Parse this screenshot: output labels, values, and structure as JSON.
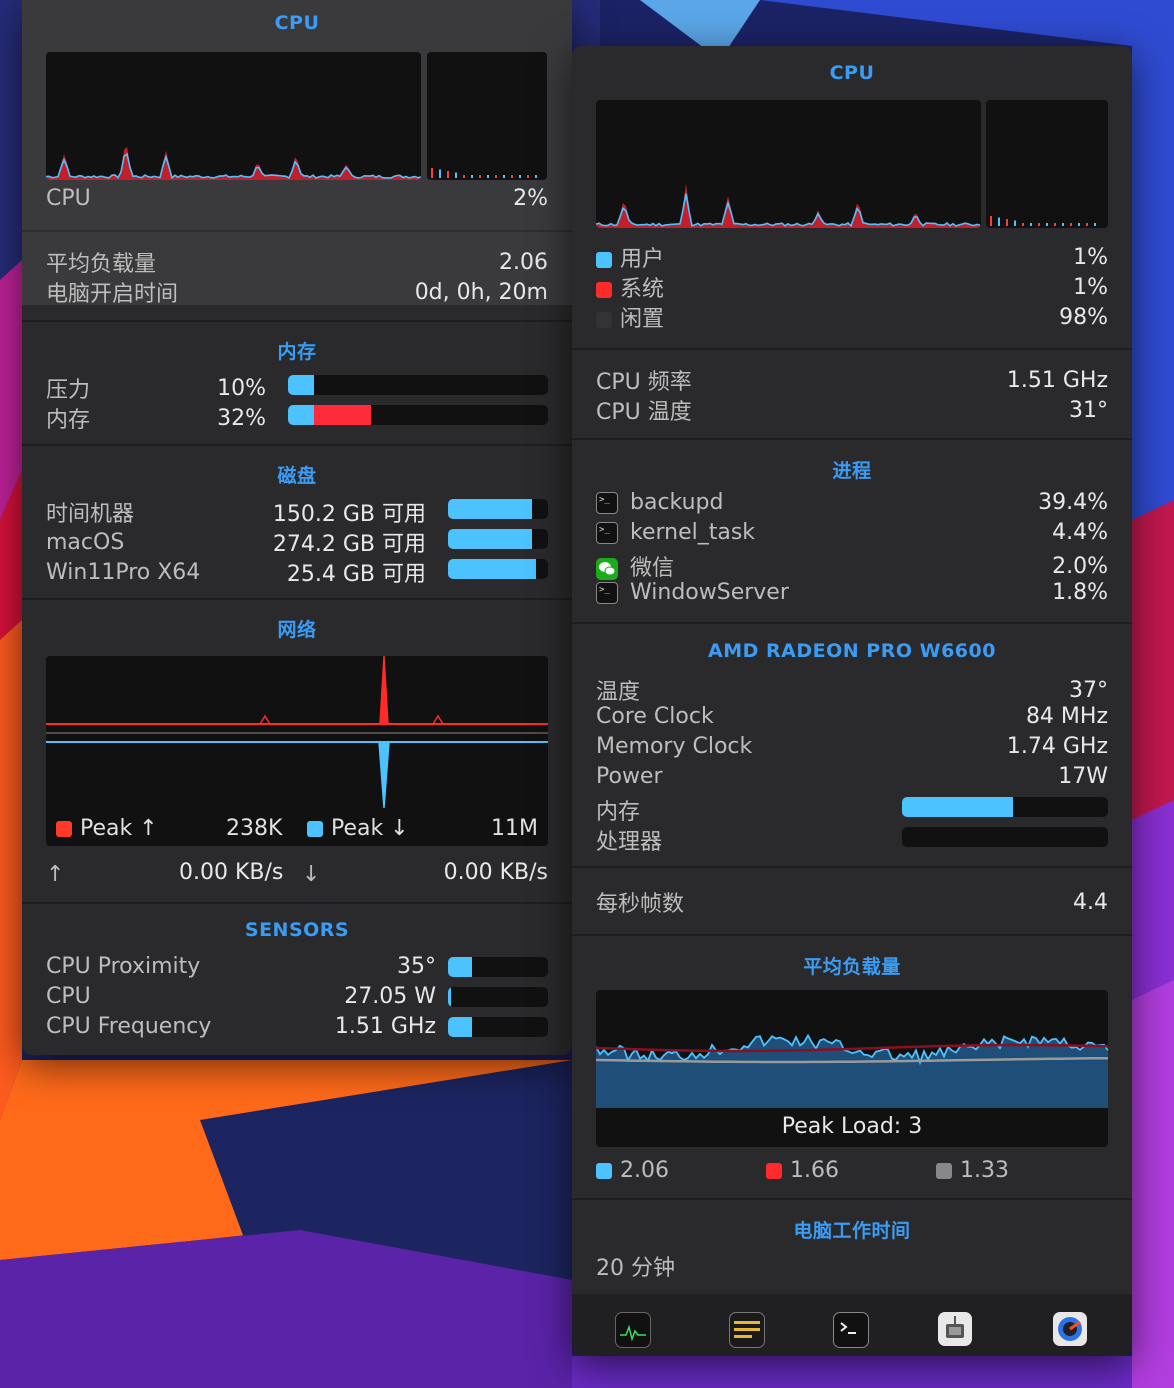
{
  "colors": {
    "accent": "#3b9cf5",
    "user_blue": "#4cc3ff",
    "system_red": "#ff2a2a",
    "idle_dark": "#333333",
    "gray": "#888888"
  },
  "left": {
    "cpu": {
      "title": "CPU",
      "label": "CPU",
      "value": "2%",
      "load_label": "平均负载量",
      "load_value": "2.06",
      "uptime_label": "电脑开启时间",
      "uptime_value": "0d, 0h, 20m"
    },
    "memory": {
      "title": "内存",
      "rows": [
        {
          "label": "压力",
          "value": "10%",
          "fill": 0.1
        },
        {
          "label": "内存",
          "value": "32%",
          "fill": 0.32
        }
      ]
    },
    "disk": {
      "title": "磁盘",
      "rows": [
        {
          "label": "时间机器",
          "value": "150.2 GB 可用",
          "fill": 0.84
        },
        {
          "label": "macOS",
          "value": "274.2 GB 可用",
          "fill": 0.84
        },
        {
          "label": "Win11Pro X64",
          "value": "25.4 GB 可用",
          "fill": 0.88
        }
      ]
    },
    "network": {
      "title": "网络",
      "peak_up_label": "Peak ↑",
      "peak_up_value": "238K",
      "peak_down_label": "Peak ↓",
      "peak_down_value": "11M",
      "up_icon": "arrow-up-icon",
      "up_rate": "0.00 KB/s",
      "down_icon": "arrow-down-icon",
      "down_rate": "0.00 KB/s"
    },
    "sensors": {
      "title": "SENSORS",
      "rows": [
        {
          "label": "CPU Proximity",
          "value": "35°",
          "fill": 0.24
        },
        {
          "label": "CPU",
          "value": "27.05 W",
          "fill": 0.03
        },
        {
          "label": "CPU Frequency",
          "value": "1.51 GHz",
          "fill": 0.24
        }
      ]
    }
  },
  "right": {
    "cpu": {
      "title": "CPU",
      "user_label": "用户",
      "user_value": "1%",
      "system_label": "系统",
      "system_value": "1%",
      "idle_label": "闲置",
      "idle_value": "98%",
      "freq_label": "CPU 频率",
      "freq_value": "1.51 GHz",
      "temp_label": "CPU 温度",
      "temp_value": "31°"
    },
    "processes": {
      "title": "进程",
      "items": [
        {
          "name": "backupd",
          "value": "39.4%",
          "icon": "terminal-icon"
        },
        {
          "name": "kernel_task",
          "value": "4.4%",
          "icon": "terminal-icon"
        },
        {
          "name": "微信",
          "value": "2.0%",
          "icon": "wechat-icon"
        },
        {
          "name": "WindowServer",
          "value": "1.8%",
          "icon": "terminal-icon"
        }
      ]
    },
    "gpu": {
      "title": "AMD RADEON PRO W6600",
      "temp_label": "温度",
      "temp_value": "37°",
      "core_label": "Core Clock",
      "core_value": "84 MHz",
      "mem_clock_label": "Memory Clock",
      "mem_clock_value": "1.74 GHz",
      "power_label": "Power",
      "power_value": "17W",
      "memory_label": "内存",
      "memory_fill": 0.54,
      "processor_label": "处理器",
      "processor_fill": 0.0
    },
    "fps": {
      "label": "每秒帧数",
      "value": "4.4"
    },
    "load": {
      "title": "平均负载量",
      "peak_label": "Peak Load: 3",
      "legend": [
        {
          "value": "2.06",
          "color": "#4cc3ff"
        },
        {
          "value": "1.66",
          "color": "#ff2a2a"
        },
        {
          "value": "1.33",
          "color": "#888888"
        }
      ]
    },
    "uptime": {
      "title": "电脑工作时间",
      "value": "20 分钟"
    },
    "dock": [
      "activity-monitor-icon",
      "console-icon",
      "terminal-icon",
      "system-information-icon",
      "disk-utility-icon"
    ]
  }
}
